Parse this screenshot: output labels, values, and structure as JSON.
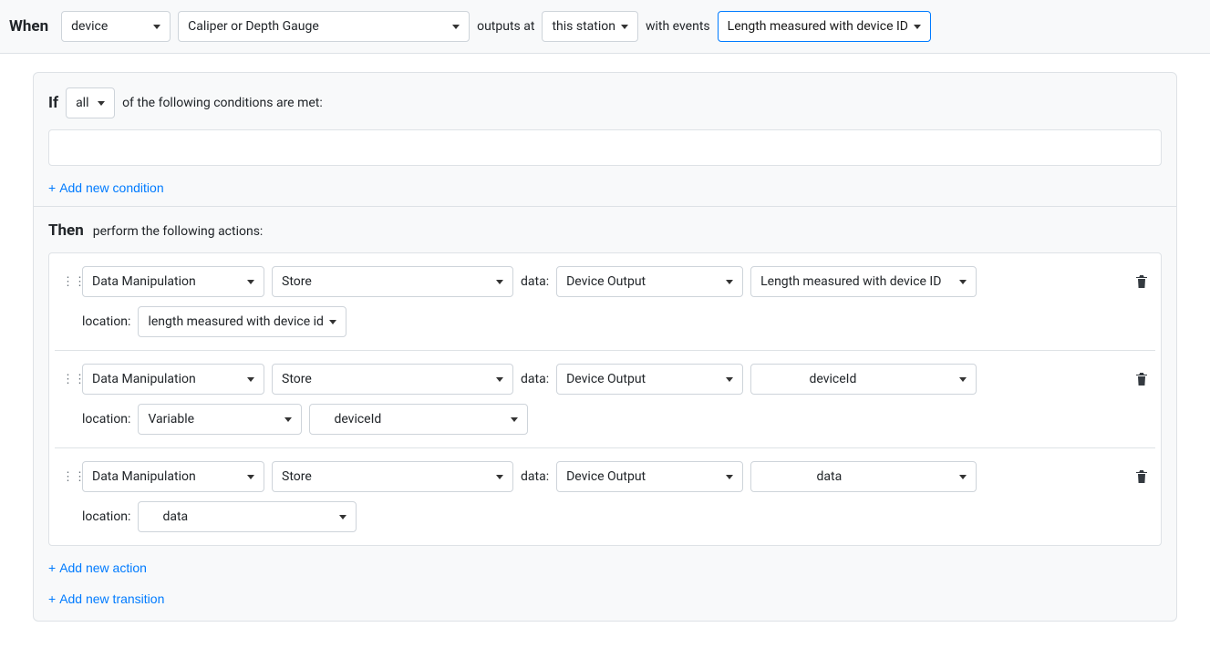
{
  "when": {
    "keyword": "When",
    "subject": "device",
    "device_name": "Caliper or Depth Gauge",
    "outputs_label": "outputs at",
    "station": "this station",
    "with_events_label": "with events",
    "event": "Length measured with device ID"
  },
  "if": {
    "keyword": "If",
    "quantifier": "all",
    "suffix": "of the following conditions are met:",
    "add_condition_label": "Add new condition"
  },
  "then": {
    "keyword": "Then",
    "suffix": "perform the following actions:",
    "add_action_label": "Add new action",
    "add_transition_label": "Add new transition",
    "actions": [
      {
        "type": "Data Manipulation",
        "operation": "Store",
        "data_label": "data:",
        "data_source": "Device Output",
        "data_field": "Length measured with device ID",
        "location_label": "location:",
        "location_value": "length measured with device id",
        "location_value2": null
      },
      {
        "type": "Data Manipulation",
        "operation": "Store",
        "data_label": "data:",
        "data_source": "Device Output",
        "data_field": "deviceId",
        "location_label": "location:",
        "location_value": "Variable",
        "location_value2": "deviceId"
      },
      {
        "type": "Data Manipulation",
        "operation": "Store",
        "data_label": "data:",
        "data_source": "Device Output",
        "data_field": "data",
        "location_label": "location:",
        "location_value": "data",
        "location_value2": null
      }
    ]
  }
}
